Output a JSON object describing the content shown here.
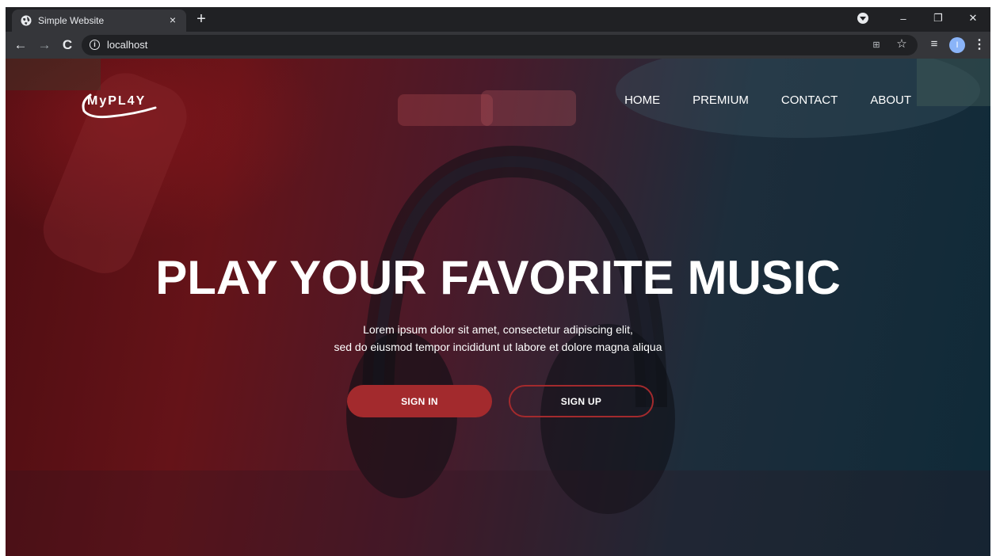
{
  "browser": {
    "tab_title": "Simple Website",
    "tab_close": "×",
    "new_tab": "+",
    "url": "localhost",
    "window_controls": {
      "minimize": "–",
      "restore": "❐",
      "close": "✕"
    },
    "profile_initial": "I",
    "icons": [
      "globe-icon",
      "back-arrow-icon",
      "forward-arrow-icon",
      "reload-icon",
      "info-icon",
      "translate-icon",
      "star-icon",
      "media-control-icon",
      "kebab-menu-icon"
    ]
  },
  "site": {
    "logo": "MyPL4Y",
    "nav": [
      "HOME",
      "PREMIUM",
      "CONTACT",
      "ABOUT"
    ],
    "hero": {
      "title": "PLAY YOUR FAVORITE MUSIC",
      "subtitle_lines": [
        "Lorem ipsum dolor sit amet, consectetur adipiscing elit,",
        "sed do eiusmod tempor incididunt ut labore et dolore magna aliqua"
      ]
    },
    "buttons": {
      "sign_in": "SIGN IN",
      "sign_up": "SIGN UP"
    },
    "colors": {
      "accent": "#a32a2d"
    }
  }
}
